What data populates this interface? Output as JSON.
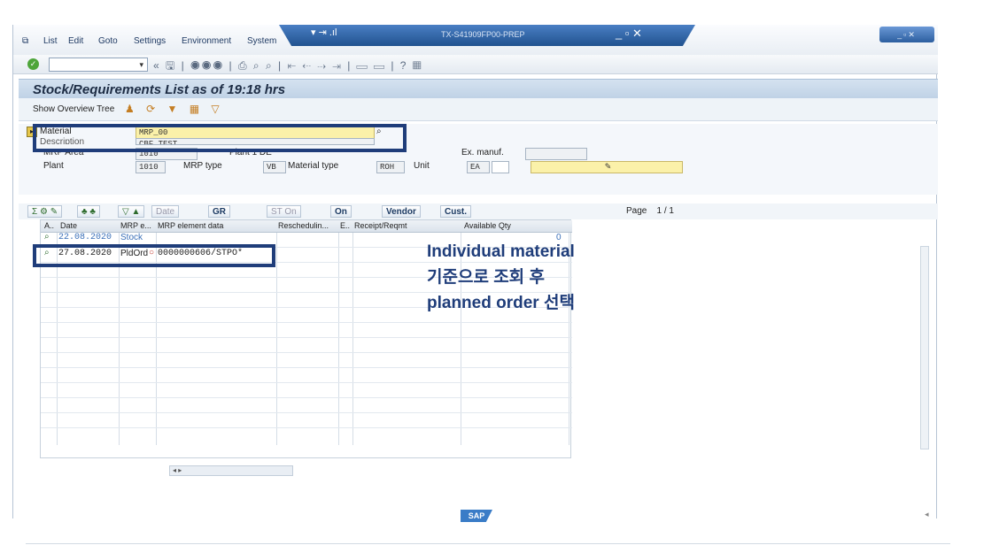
{
  "menu": {
    "items": [
      "List",
      "Edit",
      "Goto",
      "Settings",
      "Environment",
      "System"
    ],
    "window_title": "TX-S41909FP00-PREP"
  },
  "header": {
    "title": "Stock/Requirements List as of 19:18 hrs",
    "show_overview": "Show Overview Tree"
  },
  "form": {
    "material_label": "Material",
    "material_value": "MRP_00",
    "description_label": "Description",
    "description_value": "CBF TEST",
    "mrp_area_label": "MRP Area",
    "mrp_area_value": "1010",
    "plant_desc": "Plant 1 DE",
    "plant_label": "Plant",
    "plant_value": "1010",
    "mrp_type_label": "MRP type",
    "mrp_type_value": "VB",
    "material_type_label": "Material type",
    "material_type_value": "ROH",
    "unit_label": "Unit",
    "unit_value": "EA",
    "ex_manuf_label": "Ex. manuf."
  },
  "gridbar": {
    "date": "Date",
    "gr": "GR",
    "st_on": "ST On",
    "on": "On",
    "vendor": "Vendor",
    "cust": "Cust.",
    "page": "Page",
    "page_value": "1  /  1"
  },
  "grid": {
    "columns": [
      "A..",
      "Date",
      "MRP e...",
      "MRP element data",
      "Reschedulin...",
      "E..",
      "Receipt/Reqmt",
      "Available Qty"
    ],
    "rows": [
      {
        "date": "22.08.2020",
        "element": "Stock",
        "data": "",
        "available": "0"
      },
      {
        "date": "27.08.2020",
        "element": "PldOrd",
        "data": "0000000606/STPO*",
        "available": ""
      }
    ]
  },
  "annotation": {
    "line1": "Individual material",
    "line2": "기준으로 조회 후",
    "line3": "planned order 선택"
  },
  "footer": {
    "logo": "SAP"
  }
}
